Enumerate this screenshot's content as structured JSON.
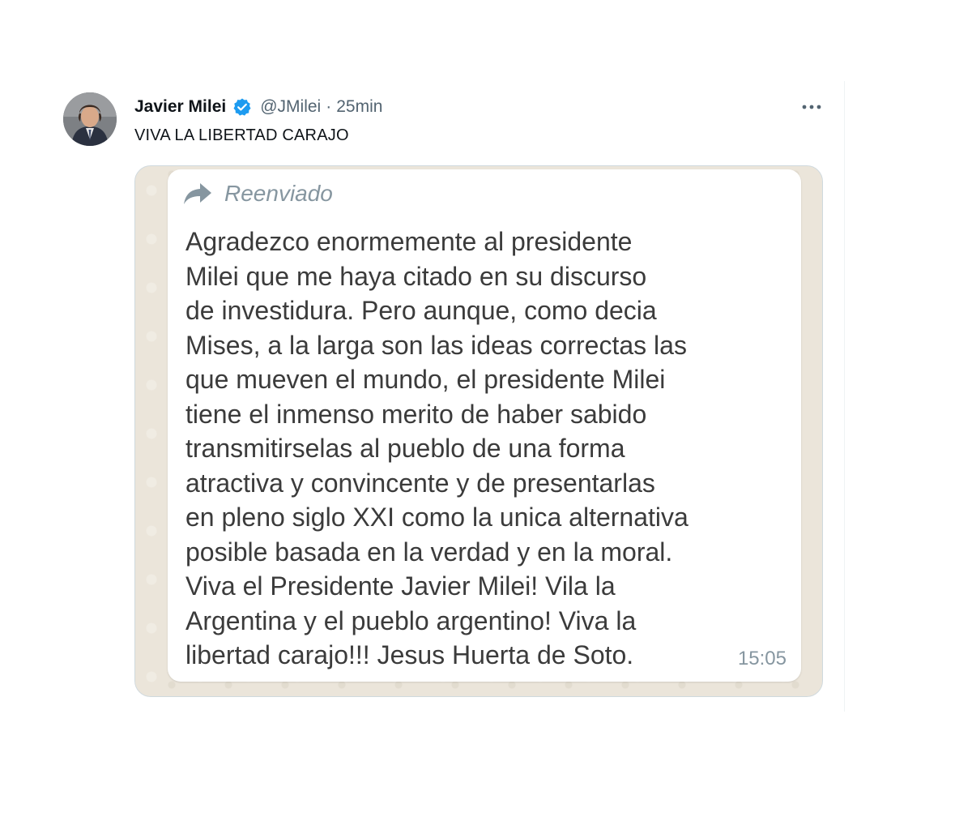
{
  "tweet": {
    "author": {
      "display_name": "Javier Milei",
      "handle": "@JMilei",
      "verified": true,
      "avatar_icon": "profile-photo"
    },
    "separator": "·",
    "timestamp": "25min",
    "text": "VIVA LA LIBERTAD CARAJO",
    "more_icon": "more-horizontal-icon",
    "media": {
      "forwarded_label": "Reenviado",
      "forward_icon": "forward-arrow-icon",
      "message_lines": [
        "Agradezco enormemente al presidente",
        "Milei que me haya citado en su discurso",
        "de investidura. Pero aunque, como decia",
        "Mises, a la larga son las ideas correctas las",
        "que mueven el mundo, el presidente Milei",
        "tiene el inmenso merito de haber sabido",
        "transmitirselas al pueblo de una forma",
        "atractiva y convincente y de presentarlas",
        "en pleno siglo XXI como la unica alternativa",
        "posible basada en la verdad y en la moral.",
        "Viva el Presidente Javier Milei! Vila la",
        "Argentina y el pueblo argentino! Viva la",
        "libertad carajo!!! Jesus Huerta de Soto."
      ],
      "message_time": "15:05"
    }
  },
  "colors": {
    "verified_blue": "#1d9bf0",
    "secondary_text": "#536471",
    "chat_background": "#ebe5da",
    "whatsapp_meta": "#8696a0"
  }
}
